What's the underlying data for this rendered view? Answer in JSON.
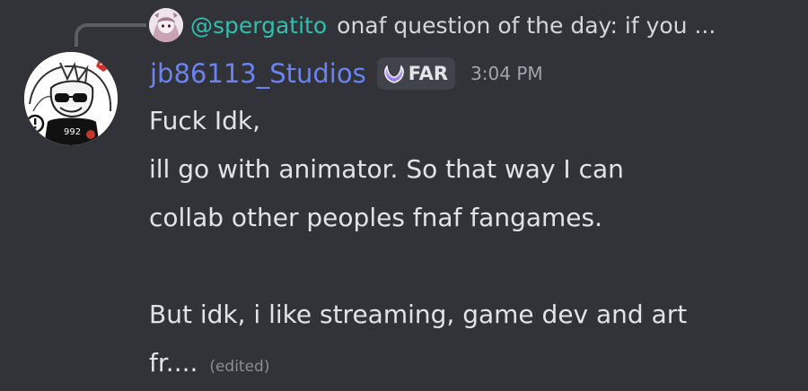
{
  "reply": {
    "username": "@spergatito",
    "preview": "onaf question of the day: if you ..."
  },
  "author": {
    "username": "jb86113_Studios",
    "tag": "FAR",
    "timestamp": "3:04 PM"
  },
  "message": {
    "lines": [
      "Fuck Idk,",
      "ill go with animator. So that way I can",
      "collab other peoples fnaf fangames.",
      "",
      "But idk, i like streaming, game dev and art",
      "fr...."
    ],
    "edited_label": "(edited)"
  },
  "colors": {
    "background": "#313338",
    "username": "#6b83ee",
    "reply_username": "#2fbfae",
    "text": "#e1e3e6",
    "muted": "#a2a5ad",
    "tag_background": "#41434a"
  },
  "icons": {
    "tag": "guild-tag-icon",
    "reply_spine": "reply-spine",
    "avatar": "user-avatar"
  }
}
